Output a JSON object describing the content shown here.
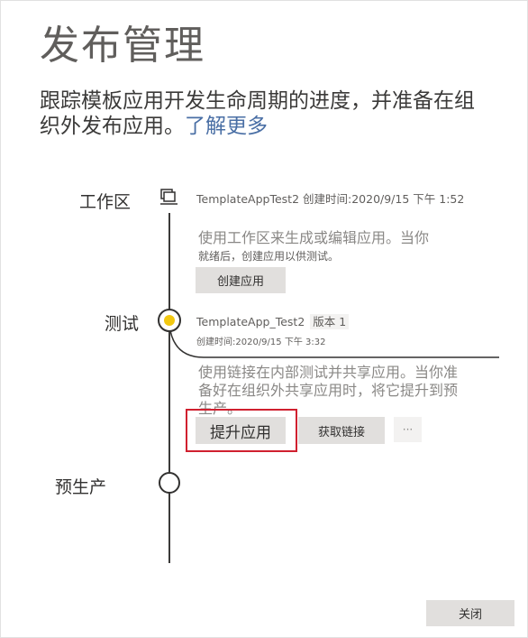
{
  "page_title": "发布管理",
  "description": {
    "text": "跟踪模板应用开发生命周期的进度，并准备在组织外发布应用。",
    "link": "了解更多"
  },
  "stages": {
    "workspace": {
      "label": "工作区",
      "meta": "TemplateAppTest2 创建时间:2020/9/15 下午 1:52",
      "desc_line1": "使用工作区来生成或编辑应用。当你",
      "desc_line2": "就绪后，创建应用以供测试。",
      "button": "创建应用"
    },
    "test": {
      "label": "测试",
      "app_name": "TemplateApp_Test2",
      "version": "版本 1",
      "created": "创建时间:2020/9/15 下午 3:32",
      "desc": "使用链接在内部测试并共享应用。当你准备好在组织外共享应用时，将它提升到预生产。",
      "promote_button": "提升应用",
      "get_link_button": "获取链接",
      "more_button": "···"
    },
    "preprod": {
      "label": "预生产"
    }
  },
  "footer": {
    "close_button": "关闭"
  },
  "colors": {
    "active_node": "#f2c811",
    "highlight_border": "#d0202f",
    "button_bg": "#e1dfdd"
  }
}
